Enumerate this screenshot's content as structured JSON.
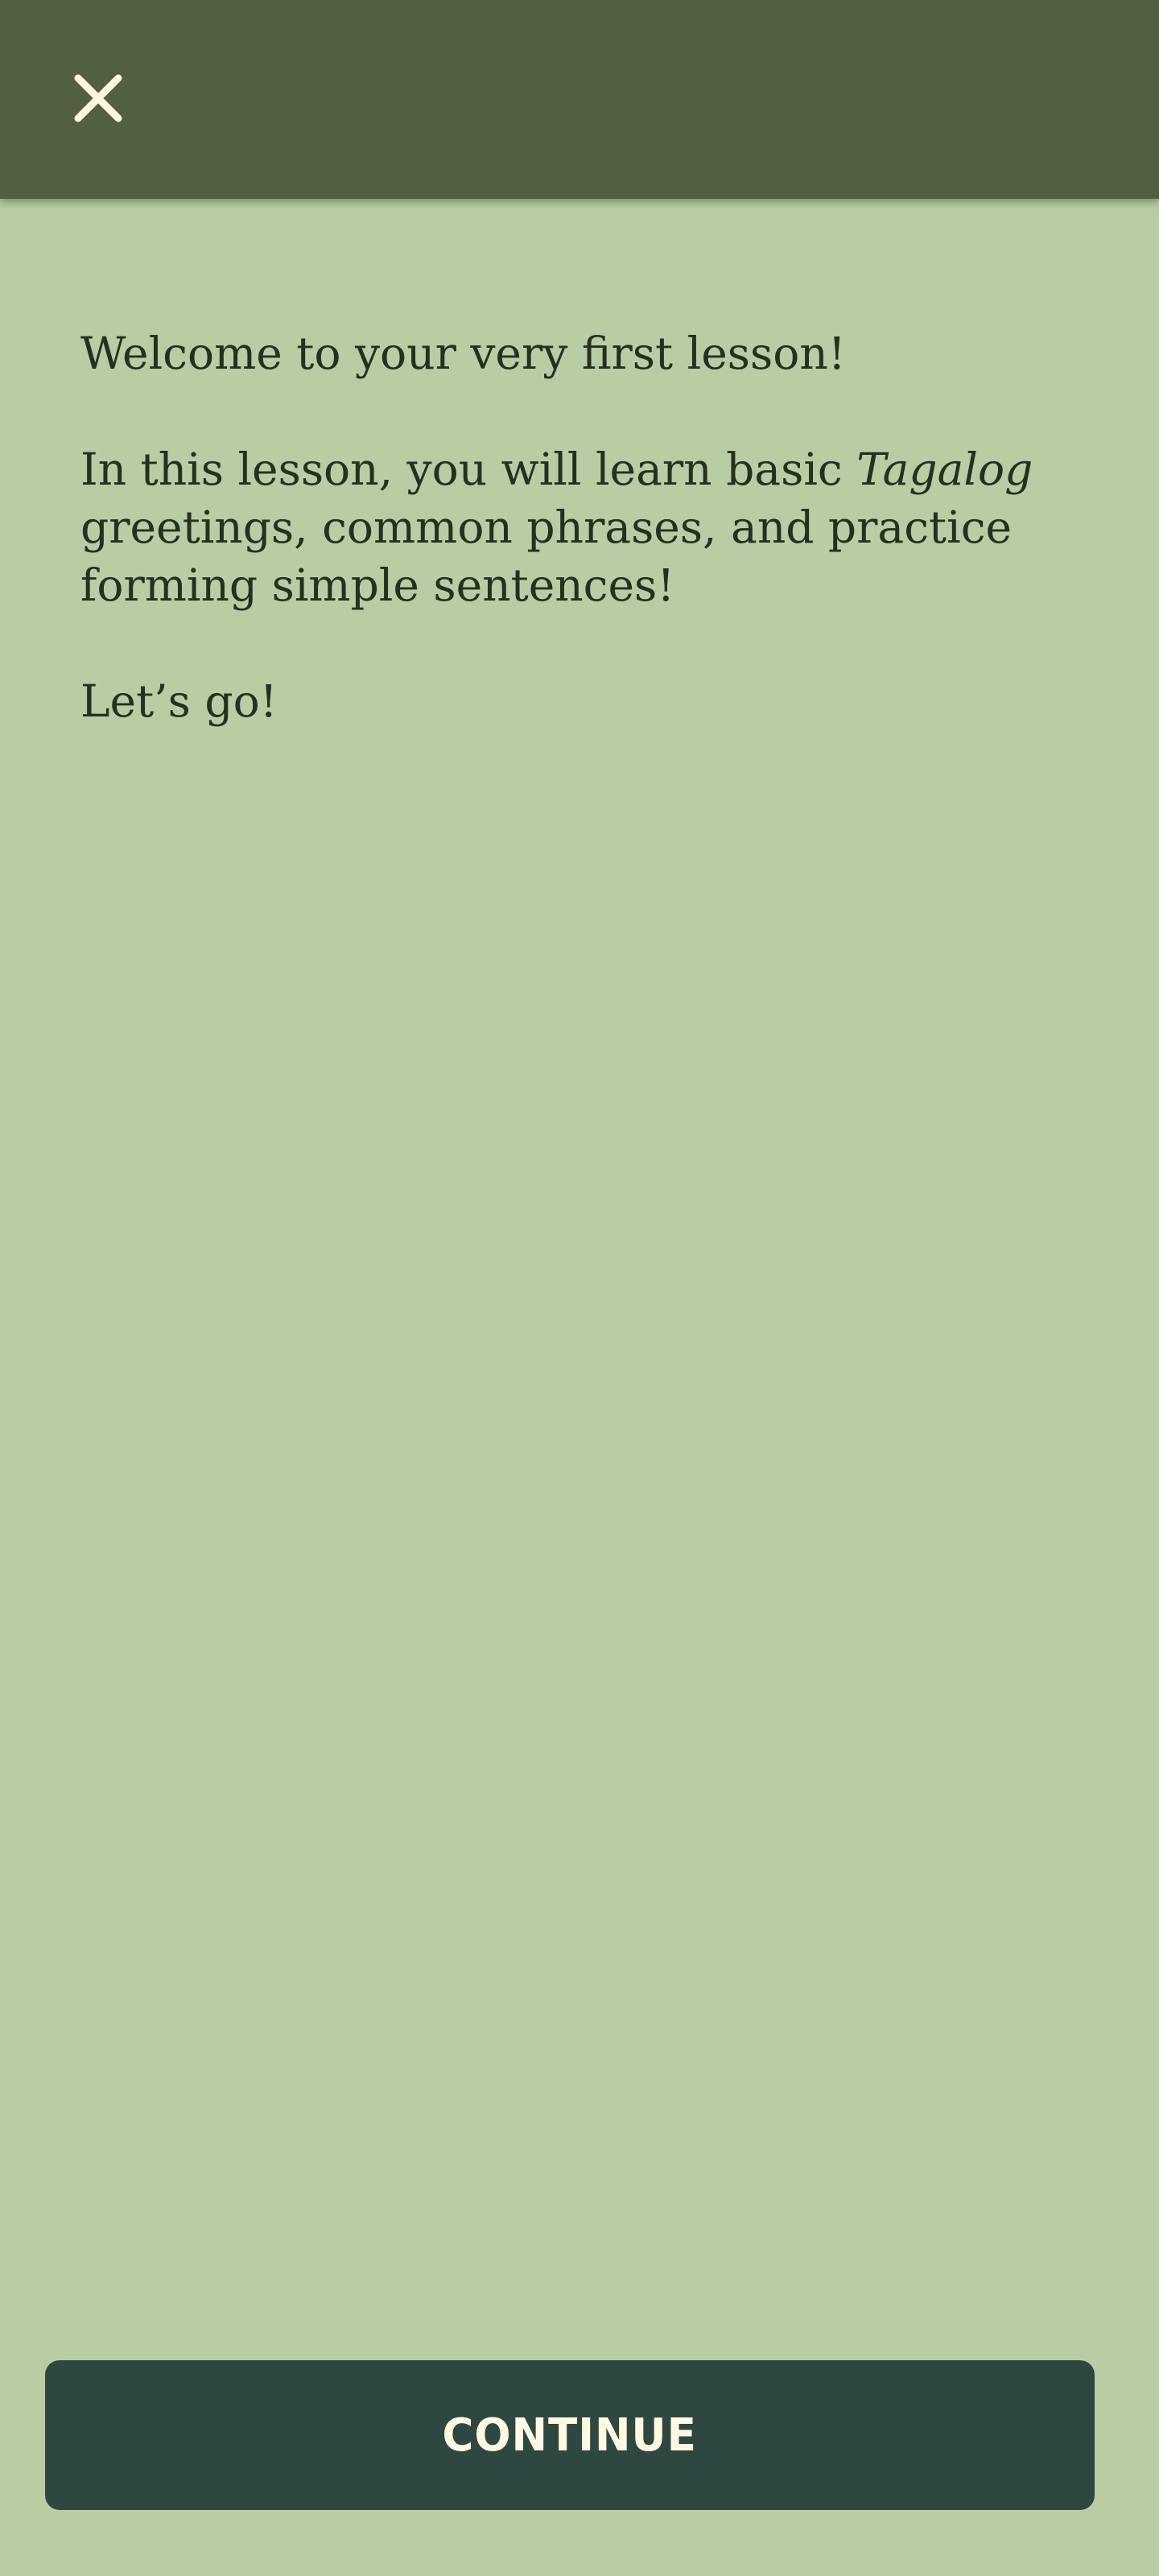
{
  "header": {
    "close_icon": "close-icon"
  },
  "lesson_intro": {
    "welcome": "Welcome to your very first lesson!",
    "description_prefix": "In this lesson, you will learn basic ",
    "language": "Tagalog",
    "description_suffix": " greetings, common phrases, and practice forming simple sentences!",
    "closing": "Let’s go!"
  },
  "actions": {
    "continue_label": "CONTINUE"
  },
  "colors": {
    "background": "#b9cda3",
    "header": "#535f41",
    "button": "#2e4841",
    "text": "#243022",
    "button_text": "#fff9e2"
  }
}
